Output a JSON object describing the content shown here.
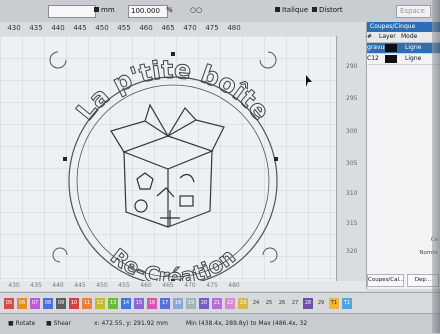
{
  "toolbar": {
    "value_left": "",
    "unit_mm": "mm",
    "value_mid": "100.000",
    "italic_label": "Italique",
    "distort_label": "Distort",
    "spacing_label": "Espace"
  },
  "ruler": {
    "top_ticks": [
      "430",
      "435",
      "440",
      "445",
      "450",
      "455",
      "460",
      "465",
      "470",
      "475",
      "480"
    ],
    "right_ticks": [
      "290",
      "295",
      "300",
      "305",
      "310",
      "315",
      "320"
    ],
    "bottom_ticks": [
      "430",
      "435",
      "440",
      "445",
      "450",
      "455",
      "460",
      "465",
      "470",
      "475",
      "480"
    ]
  },
  "panel": {
    "title": "Coupes/Cinque",
    "columns": [
      "#",
      "Layer",
      "Mode"
    ],
    "rows": [
      {
        "id": "gravure",
        "mode": "Ligne"
      },
      {
        "id": "C12",
        "mode": "Ligne"
      }
    ],
    "extra1": "Ce",
    "extra2": "Nombr",
    "tab_left": "Coupes/Cal...",
    "tab_right": "Dep..."
  },
  "logo": {
    "top_text": "La p'tite boîte",
    "bottom_text": "Re-Création"
  },
  "palette": {
    "chips": [
      "05",
      "06",
      "07",
      "08",
      "09",
      "10",
      "11",
      "12",
      "13",
      "14",
      "15",
      "16",
      "17",
      "18",
      "19",
      "20",
      "21",
      "22",
      "23",
      "24",
      "25",
      "26",
      "27",
      "28",
      "29",
      "T1",
      "T2"
    ]
  },
  "status": {
    "rotate": "Rotate",
    "shear": "Shear",
    "coords": "x: 472.55, y: 291.92 mm",
    "range": "Min (438.4x, 289.8y) to Max (486.4x, 32"
  }
}
